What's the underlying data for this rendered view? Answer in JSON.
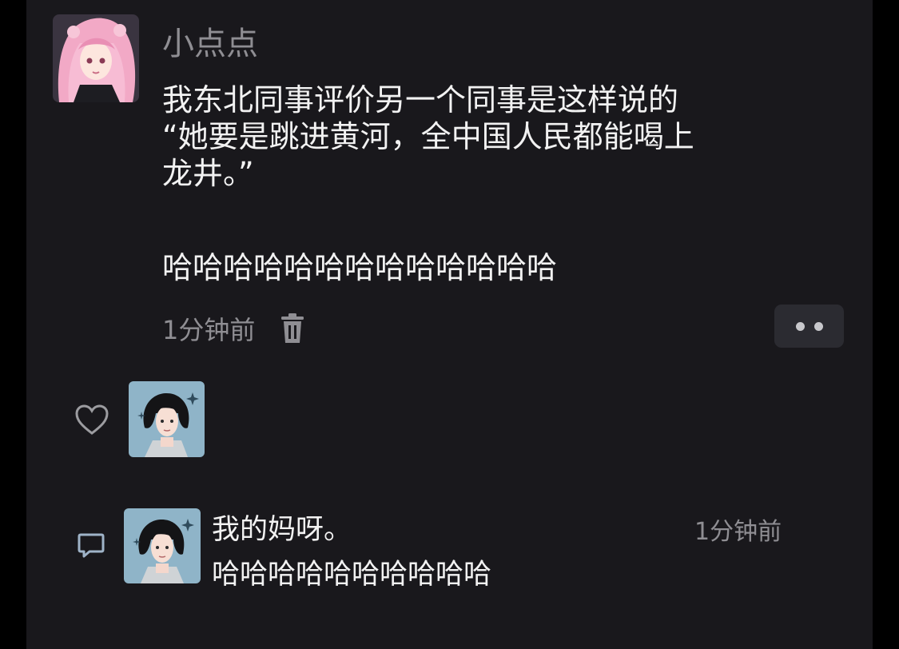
{
  "post": {
    "author": "小点点",
    "lines": [
      "我东北同事评价另一个同事是这样说的",
      "“她要是跳进黄河，全中国人民都能喝上",
      "龙井。”"
    ],
    "laugh": "哈哈哈哈哈哈哈哈哈哈哈哈哈",
    "time": "1分钟前",
    "icons": {
      "delete": "trash-icon",
      "more": "more-dots-icon"
    }
  },
  "likes": {
    "icon": "heart-icon"
  },
  "reply": {
    "icon": "comment-icon",
    "line1": "我的妈呀。",
    "line2": "哈哈哈哈哈哈哈哈哈哈",
    "time": "1分钟前"
  },
  "colors": {
    "background": "#19181c",
    "text": "#f2f2f2",
    "muted": "#8f8e93",
    "button": "#2b2b31"
  }
}
